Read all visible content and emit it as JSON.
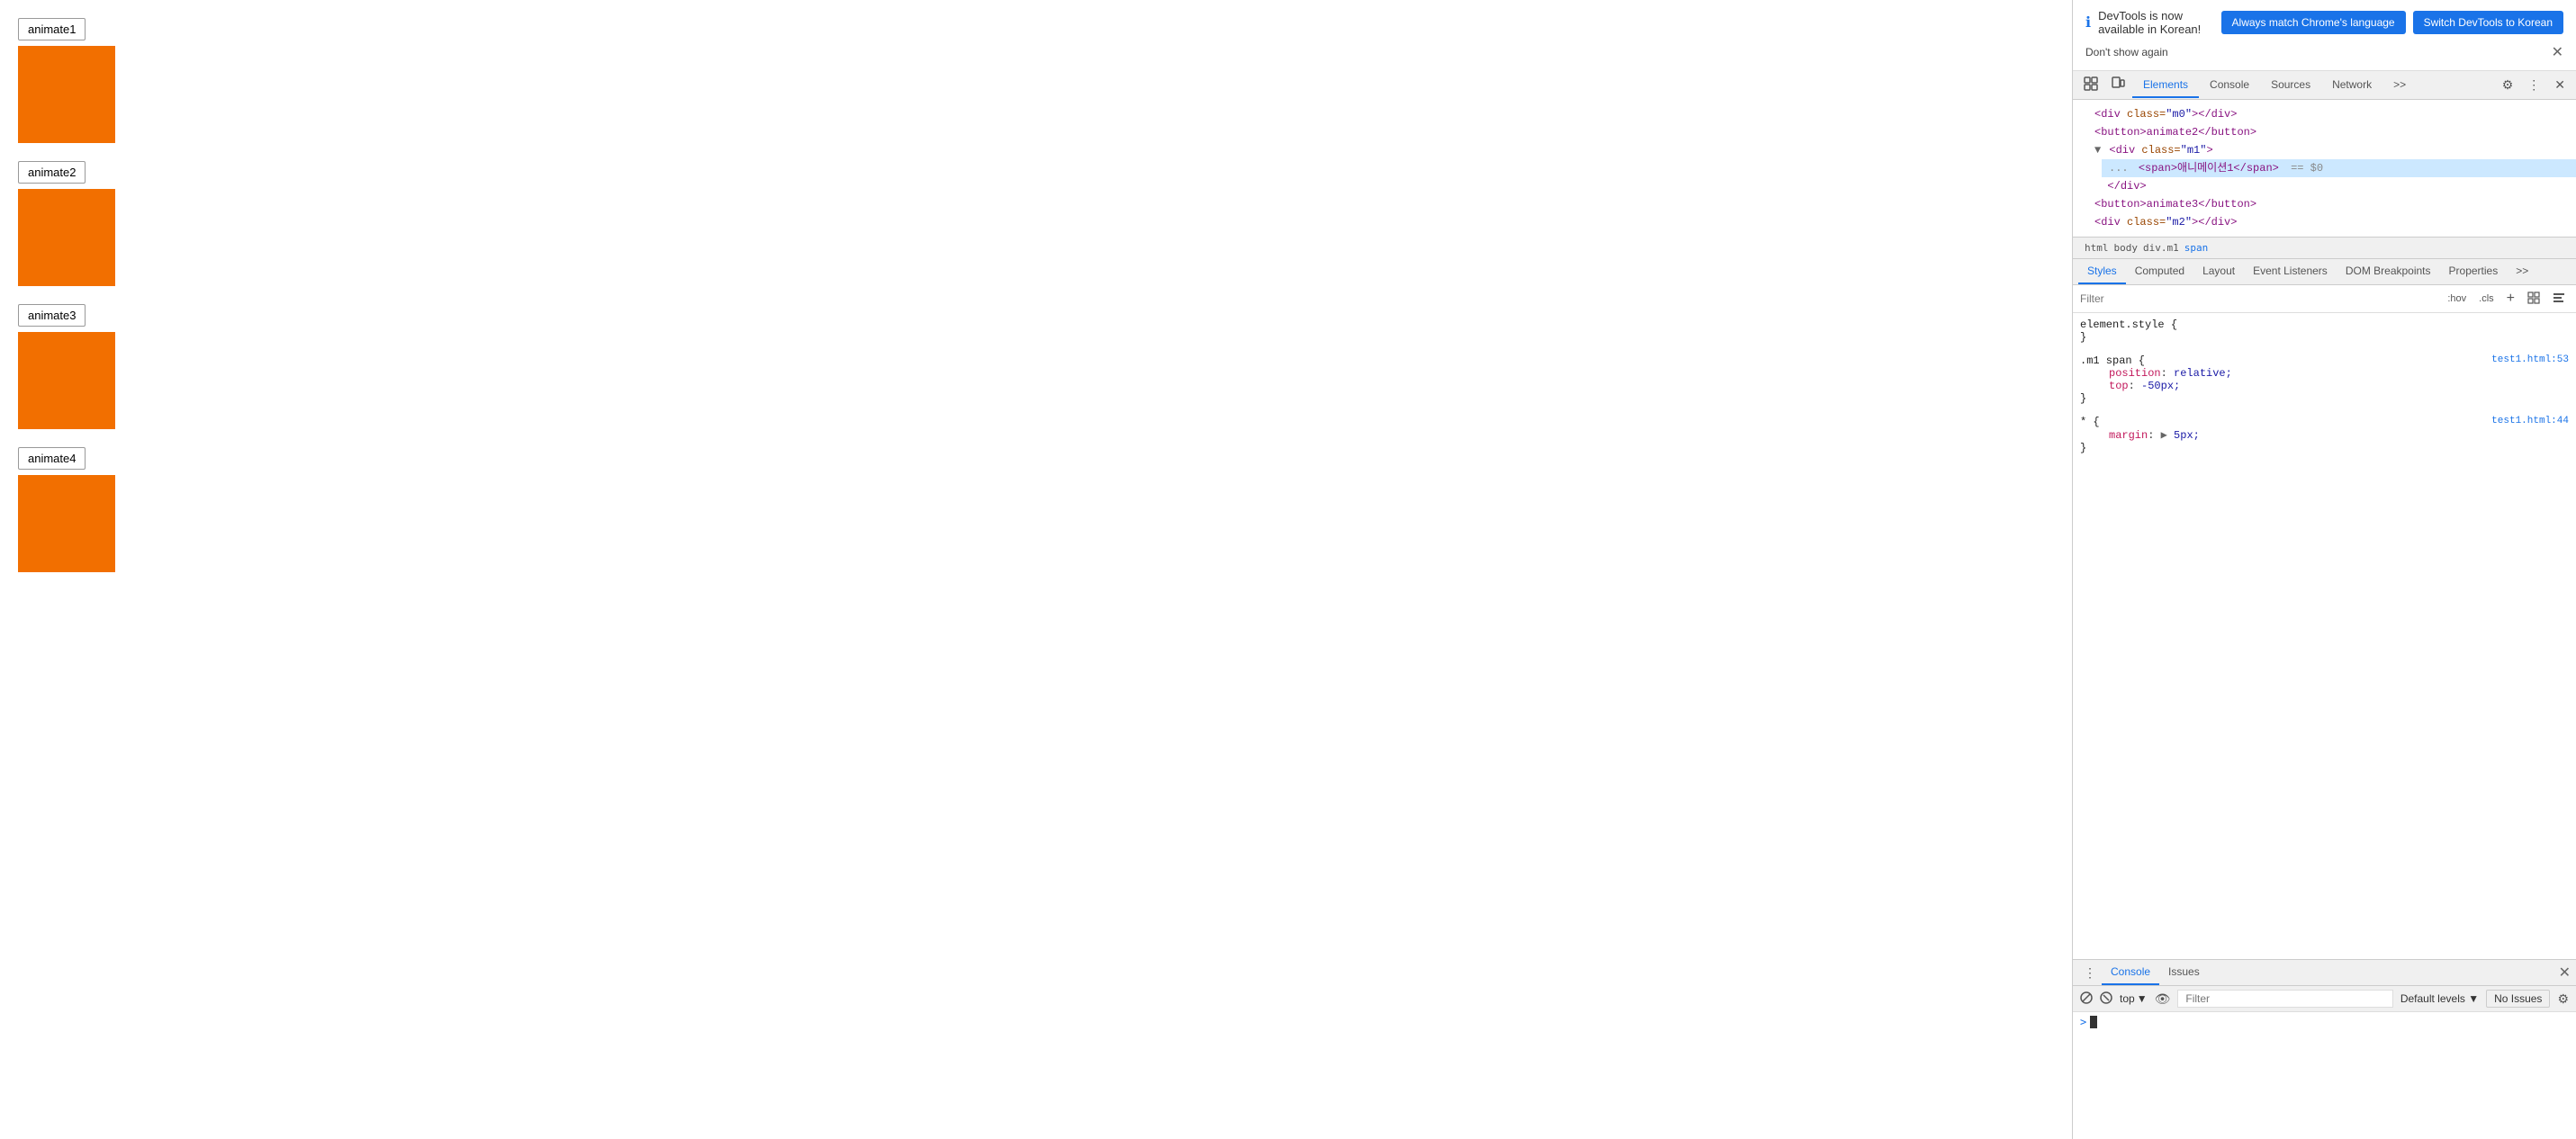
{
  "main": {
    "buttons": [
      {
        "label": "animate1"
      },
      {
        "label": "animate2"
      },
      {
        "label": "animate3"
      },
      {
        "label": "animate4"
      }
    ]
  },
  "notification": {
    "info_text": "DevTools is now available in Korean!",
    "btn1_label": "Always match Chrome's language",
    "btn2_label": "Switch DevTools to Korean",
    "dont_show_label": "Don't show again"
  },
  "devtools": {
    "tabs": [
      {
        "label": "Elements",
        "active": true
      },
      {
        "label": "Console"
      },
      {
        "label": "Sources"
      },
      {
        "label": "Network"
      },
      {
        "label": ">>"
      }
    ],
    "html_tree": {
      "lines": [
        {
          "indent": 2,
          "content": "<div class=\"m0\"></div>",
          "type": "tag"
        },
        {
          "indent": 2,
          "content": "<button>animate2</button>",
          "type": "tag"
        },
        {
          "indent": 2,
          "content": "<div class=\"m1\">",
          "type": "tag",
          "open": true
        },
        {
          "indent": 3,
          "content": "<span>애니메이션1</span>",
          "type": "selected",
          "suffix": " == $0"
        },
        {
          "indent": 3,
          "content": "</div>",
          "type": "tag"
        },
        {
          "indent": 2,
          "content": "<button>animate3</button>",
          "type": "tag"
        },
        {
          "indent": 2,
          "content": "<div class=\"m2\"></div>",
          "type": "tag"
        }
      ]
    },
    "breadcrumb": [
      "html",
      "body",
      "div.m1",
      "span"
    ],
    "styles_tabs": [
      {
        "label": "Styles",
        "active": true
      },
      {
        "label": "Computed"
      },
      {
        "label": "Layout"
      },
      {
        "label": "Event Listeners"
      },
      {
        "label": "DOM Breakpoints"
      },
      {
        "label": "Properties"
      },
      {
        "label": ">>"
      }
    ],
    "filter_placeholder": "Filter",
    "filter_pseudo": ":hov",
    "filter_cls": ".cls",
    "css_rules": [
      {
        "selector": "element.style {",
        "close": "}",
        "source": "",
        "props": []
      },
      {
        "selector": ".m1 span {",
        "close": "}",
        "source": "test1.html:53",
        "props": [
          {
            "name": "position",
            "value": "relative;"
          },
          {
            "name": "top",
            "value": "-50px;"
          }
        ]
      },
      {
        "selector": "* {",
        "close": "}",
        "source": "test1.html:44",
        "props": [
          {
            "name": "margin",
            "value": "▶ 5px;",
            "has_triangle": true
          }
        ]
      }
    ]
  },
  "console": {
    "tabs": [
      {
        "label": "Console",
        "active": true
      },
      {
        "label": "Issues"
      }
    ],
    "top_label": "top",
    "filter_placeholder": "Filter",
    "default_levels_label": "Default levels ▼",
    "no_issues_label": "No Issues"
  }
}
